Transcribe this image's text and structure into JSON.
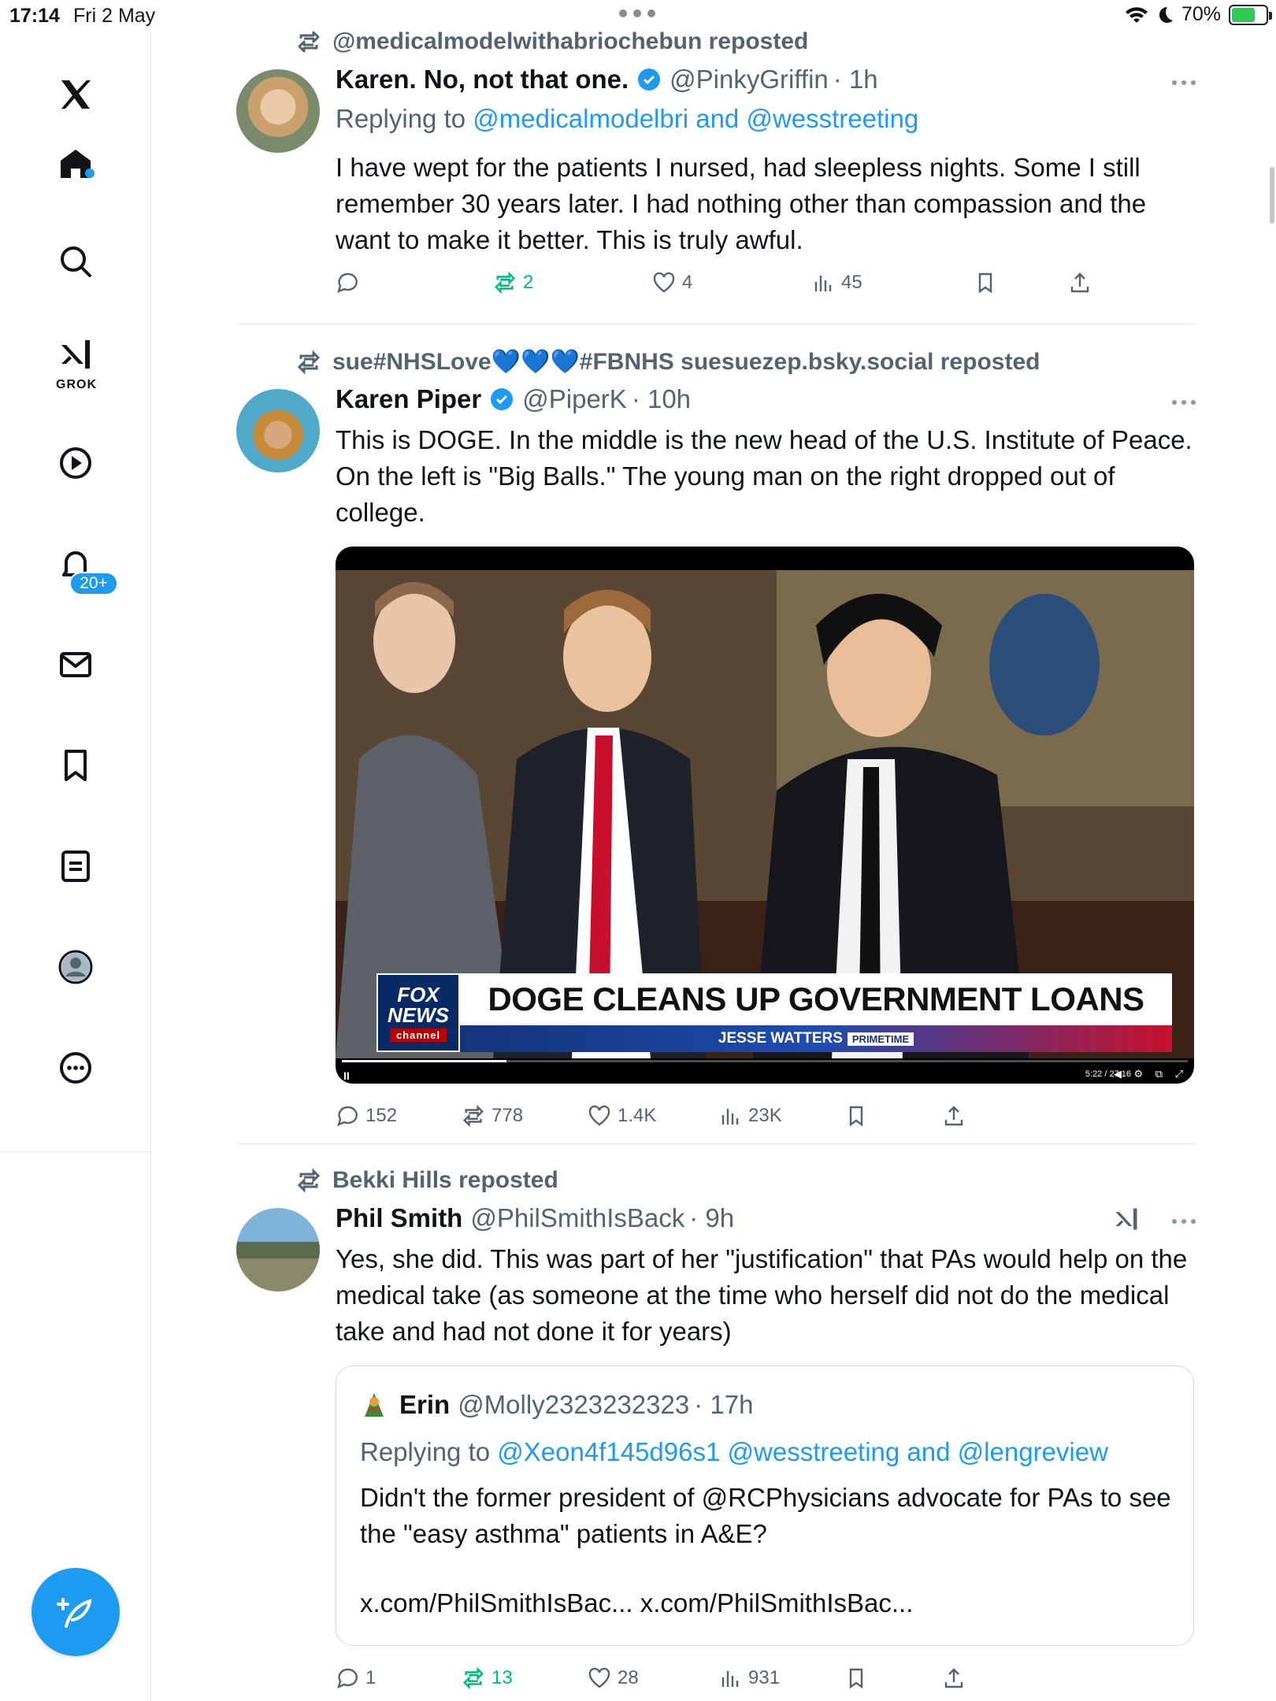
{
  "status_bar": {
    "time": "17:14",
    "date": "Fri 2 May",
    "battery": "70%"
  },
  "sidebar": {
    "items": [
      {
        "icon": "x-logo-icon",
        "label": "X"
      },
      {
        "icon": "home-icon",
        "label": "Home"
      },
      {
        "icon": "search-icon",
        "label": "Explore"
      },
      {
        "icon": "grok-icon",
        "label": "GROK"
      },
      {
        "icon": "video-icon",
        "label": "Video"
      },
      {
        "icon": "bell-icon",
        "label": "Notifications"
      },
      {
        "icon": "mail-icon",
        "label": "Messages"
      },
      {
        "icon": "bookmark-icon",
        "label": "Bookmarks"
      },
      {
        "icon": "list-icon",
        "label": "Lists"
      },
      {
        "icon": "profile-icon",
        "label": "Profile"
      },
      {
        "icon": "more-icon",
        "label": "More"
      }
    ],
    "grok_label": "GROK",
    "notifications_badge": "20+",
    "compose_icon": "compose-icon"
  },
  "colors": {
    "accent": "#1d9bf0",
    "repost_green": "#00ba7c",
    "muted": "#536471",
    "divider": "#e7e9ea"
  },
  "posts": [
    {
      "repost_by": "@medicalmodelwithabriochebun reposted",
      "author_name": "Karen. No, not that one.",
      "verified": true,
      "handle": "@PinkyGriffin",
      "time": "· 1h",
      "reply_prefix": "Replying to",
      "reply_to": "@medicalmodelbri and @wesstreeting",
      "text": "I have wept for the patients I nursed, had sleepless nights. Some I still remember 30 years later. I had nothing other than compassion and the want to make it better. This is truly awful.",
      "replies": "",
      "reposts": "2",
      "likes": "4",
      "views": "45"
    },
    {
      "repost_by": "sue#NHSLove💙💙💙#FBNHS suesuezep.bsky.social reposted",
      "author_name": "Karen Piper",
      "verified": true,
      "handle": "@PiperK",
      "time": "· 10h",
      "text": "This is DOGE. In the middle is the new head of the U.S. Institute of Peace. On the left is \"Big Balls.\" The young man on the right dropped out of college.",
      "video": {
        "logo_line1": "FOX",
        "logo_line2": "NEWS",
        "logo_line3": "channel",
        "headline": "DOGE CLEANS UP GOVERNMENT LOANS",
        "show": "JESSE WATTERS",
        "show_tag": "PRIMETIME",
        "time": "5:22 / 27:16",
        "progress": 0.195
      },
      "replies": "152",
      "reposts": "778",
      "likes": "1.4K",
      "views": "23K"
    },
    {
      "repost_by": "Bekki Hills reposted",
      "author_name": "Phil Smith",
      "verified": false,
      "handle": "@PhilSmithIsBack",
      "time": "· 9h",
      "text": "Yes, she did.  This was part of her \"justification\" that PAs would help on the medical take (as someone at the time who herself did not do the medical take and had not done it for years)",
      "quote": {
        "author_name": "Erin",
        "handle": "@Molly2323232323",
        "time": "· 17h",
        "reply_prefix": "Replying to",
        "reply_to": "@Xeon4f145d96s1 @wesstreeting and @lengreview",
        "text": "Didn't the former president of @RCPhysicians advocate for PAs to see the \"easy asthma\" patients in A&E?",
        "links": "x.com/PhilSmithIsBac... x.com/PhilSmithIsBac..."
      },
      "replies": "1",
      "reposts": "13",
      "likes": "28",
      "views": "931"
    }
  ]
}
